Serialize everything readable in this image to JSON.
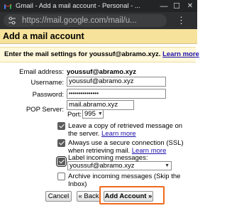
{
  "window": {
    "title": "Gmail - Add a mail account - Personal - ...",
    "minimize_glyph": "—",
    "maximize_glyph": "☐",
    "close_glyph": "✕"
  },
  "browser": {
    "url": "https://mail.google.com/mail/u...",
    "menu_glyph": "⋮"
  },
  "page": {
    "header": "Add a mail account",
    "instruction_prefix": "Enter the mail settings for youssuf@abramo.xyz.",
    "learn_more": "Learn more"
  },
  "form": {
    "email_label": "Email address:",
    "email_value": "youssuf@abramo.xyz",
    "username_label": "Username:",
    "username_value": "youssuf@abramo.xyz",
    "password_label": "Password:",
    "password_value": "•••••••••••••••",
    "pop_label": "POP Server:",
    "pop_value": "mail.abramo.xyz",
    "port_label": "Port:",
    "port_value": "995",
    "leave_copy_text": "Leave a copy of retrieved message on the server.",
    "leave_copy_link": "Learn more",
    "ssl_text": "Always use a secure connection (SSL) when retrieving mail.",
    "ssl_link": "Learn more",
    "label_text": "Label incoming messages:",
    "label_value": "youssuf@abramo.xyz",
    "archive_text": "Archive incoming messages (Skip the Inbox)"
  },
  "buttons": {
    "cancel": "Cancel",
    "back": "« Back",
    "add": "Add Account »"
  },
  "colors": {
    "header_bg": "#f6e29a",
    "instruction_bg": "#fff8dc",
    "highlight": "#ef6a1d"
  }
}
